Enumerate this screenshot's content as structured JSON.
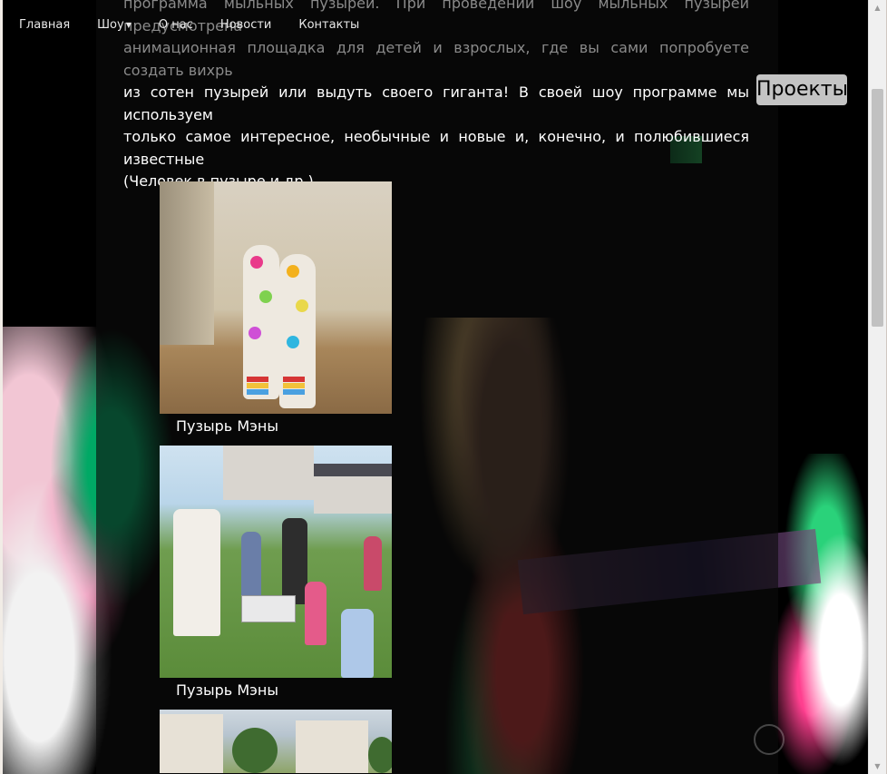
{
  "nav": {
    "items": [
      {
        "label": "Главная"
      },
      {
        "label": "Шоу",
        "has_dropdown": true
      },
      {
        "label": "О нас"
      },
      {
        "label": "Новости"
      },
      {
        "label": "Контакты"
      }
    ]
  },
  "intro": {
    "line1": "программа мыльных пузырей. При проведении шоу мыльных пузырей предусмотрена",
    "line2": "анимационная площадка для детей и взрослых, где вы сами попробуете создать вихрь",
    "line3": "из сотен пузырей или выдуть своего гиганта! В своей шоу программе мы используем",
    "line4": "только самое интересное, необычные и новые и, конечно, и полюбившиеся известные",
    "line5": "(Человек в пузыре и др.)"
  },
  "projects_button": {
    "label": "Проекты"
  },
  "gallery": {
    "items": [
      {
        "caption": "Пузырь Мэны"
      },
      {
        "caption": "Пузырь Мэны"
      }
    ]
  },
  "colors": {
    "page_bg": "#000000",
    "button_bg": "#c4c4c4",
    "text": "#ffffff"
  }
}
